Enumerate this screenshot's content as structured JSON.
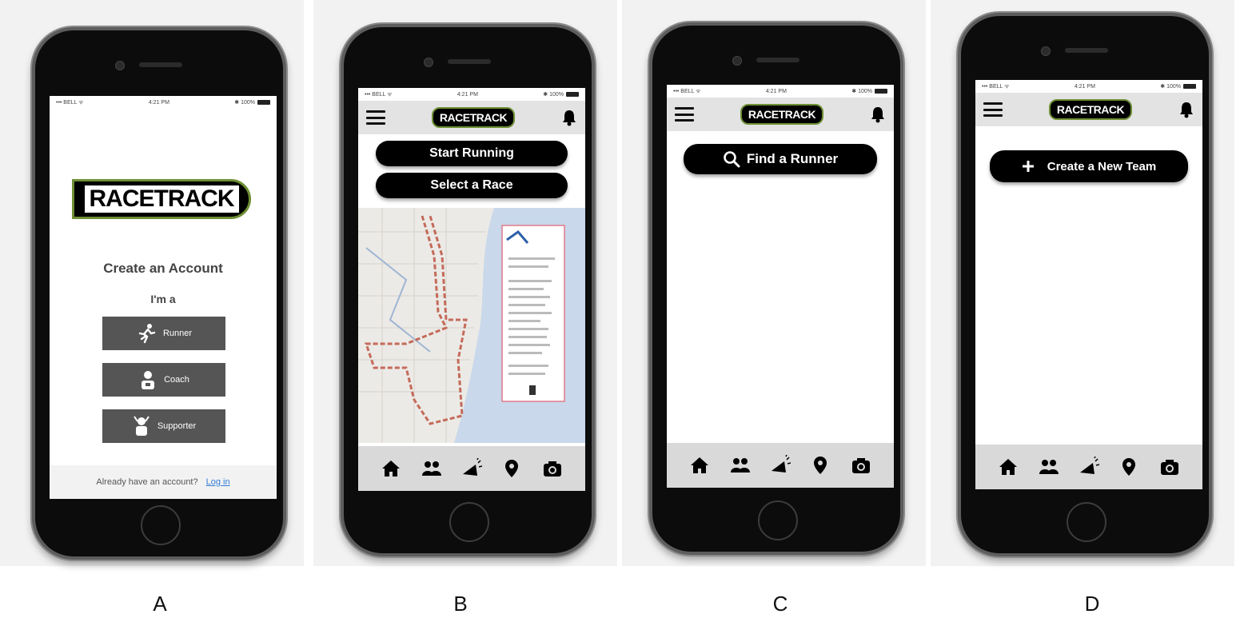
{
  "status_bar": {
    "carrier": "••• BELL ᯤ",
    "time": "4:21 PM",
    "battery": "✱ 100%"
  },
  "logo_text": "RACETRACK",
  "screen_a": {
    "title": "Create an Account",
    "subtitle": "I'm a",
    "roles": [
      {
        "label": "Runner",
        "icon": "runner-icon"
      },
      {
        "label": "Coach",
        "icon": "coach-icon"
      },
      {
        "label": "Supporter",
        "icon": "supporter-icon"
      }
    ],
    "footer_text": "Already have an account?",
    "login_link": "Log in"
  },
  "screen_b": {
    "buttons": [
      "Start Running",
      "Select a Race"
    ],
    "map": "marathon-route-map"
  },
  "screen_c": {
    "search_button": "Find a Runner",
    "icon": "search-icon"
  },
  "screen_d": {
    "create_button": "Create a New Team",
    "icon": "plus-icon"
  },
  "tab_icons": [
    "home-icon",
    "team-icon",
    "megaphone-icon",
    "location-pin-icon",
    "camera-icon"
  ],
  "captions": [
    "A",
    "B",
    "C",
    "D"
  ],
  "colors": {
    "logo_outline": "#6e8f34",
    "link": "#2f7dd6",
    "role_button": "#555555",
    "navbar": "#e3e3e3",
    "tabbar": "#d9d9d9"
  }
}
